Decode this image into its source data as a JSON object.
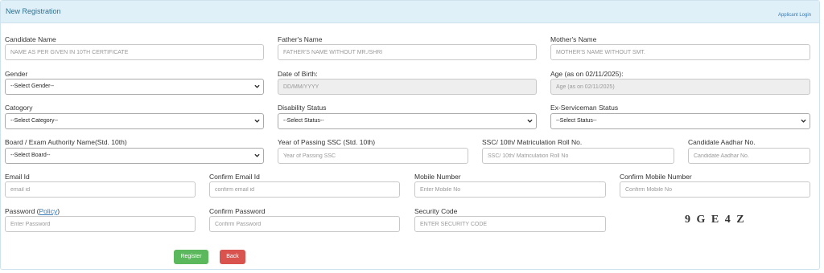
{
  "header": {
    "title": "New Registration",
    "login_link": "Applicant Login"
  },
  "fields": {
    "candidate_name": {
      "label": "Candidate Name",
      "placeholder": "NAME AS PER GIVEN IN 10TH CERTIFICATE"
    },
    "father_name": {
      "label": "Father's Name",
      "placeholder": "FATHER'S NAME WITHOUT MR./SHRI"
    },
    "mother_name": {
      "label": "Mother's Name",
      "placeholder": "MOTHER'S NAME WITHOUT SMT."
    },
    "gender": {
      "label": "Gender",
      "value": "--Select Gender--"
    },
    "dob": {
      "label": "Date of Birth:",
      "placeholder": "DD/MM/YYYY"
    },
    "age": {
      "label": "Age (as on 02/11/2025):",
      "placeholder": "Age (as on 02/11/2025)"
    },
    "category": {
      "label": "Catogory",
      "value": "--Select Category--"
    },
    "disability": {
      "label": "Disability Status",
      "value": "--Select Status--"
    },
    "ex_serviceman": {
      "label": "Ex-Serviceman Status",
      "value": "--Select Status--"
    },
    "board": {
      "label": "Board / Exam Authority Name(Std. 10th)",
      "value": "--Select Board--"
    },
    "year_ssc": {
      "label": "Year of Passing SSC (Std. 10th)",
      "placeholder": "Year of Passing SSC"
    },
    "roll_no": {
      "label": "SSC/ 10th/ Matriculation Roll No.",
      "placeholder": "SSC/ 10th/ Matriculation Roll No"
    },
    "aadhar": {
      "label": "Candidate Aadhar No.",
      "placeholder": "Candidate Aadhar No."
    },
    "email": {
      "label": "Email Id",
      "placeholder": "email id"
    },
    "confirm_email": {
      "label": "Confirm Email Id",
      "placeholder": "confirm email id"
    },
    "mobile": {
      "label": "Mobile Number",
      "placeholder": "Enter Mobile No"
    },
    "confirm_mobile": {
      "label": "Confirm Mobile Number",
      "placeholder": "Confirm Mobile No"
    },
    "password": {
      "label": "Password (",
      "link": "Policy",
      "label_end": ")",
      "placeholder": "Enter Password"
    },
    "confirm_password": {
      "label": "Confirm Password",
      "placeholder": "Confirm Password"
    },
    "security_code": {
      "label": "Security Code",
      "placeholder": "ENTER SECURITY CODE"
    }
  },
  "captcha": "9 G E 4 Z",
  "buttons": {
    "register": "Register",
    "back": "Back"
  },
  "icons": {
    "dropdown": "chevron-down-icon"
  }
}
